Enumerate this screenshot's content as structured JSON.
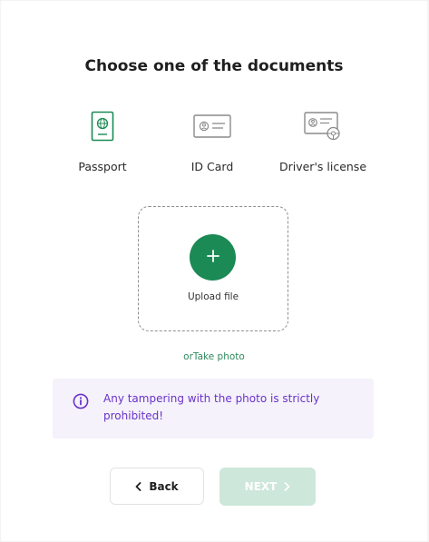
{
  "page": {
    "title": "Choose one of the documents"
  },
  "documents": [
    {
      "label": "Passport",
      "icon": "passport-icon",
      "color": "#1b8a55"
    },
    {
      "label": "ID Card",
      "icon": "id-card-icon",
      "color": "#8a8a8a"
    },
    {
      "label": "Driver's license",
      "icon": "drivers-license-icon",
      "color": "#8a8a8a"
    }
  ],
  "upload": {
    "label": "Upload file",
    "icon": "plus-icon",
    "accent": "#1b8a55"
  },
  "take_photo": {
    "text": "orTake photo"
  },
  "notice": {
    "text": "Any tampering with the photo is strictly prohibited!",
    "icon": "info-icon",
    "color": "#6a33c9",
    "background": "#f5f2fb"
  },
  "buttons": {
    "back_label": "Back",
    "back_icon": "chevron-left-icon",
    "next_label": "NEXT",
    "next_icon": "chevron-right-icon",
    "next_disabled_color": "#cde7da"
  }
}
